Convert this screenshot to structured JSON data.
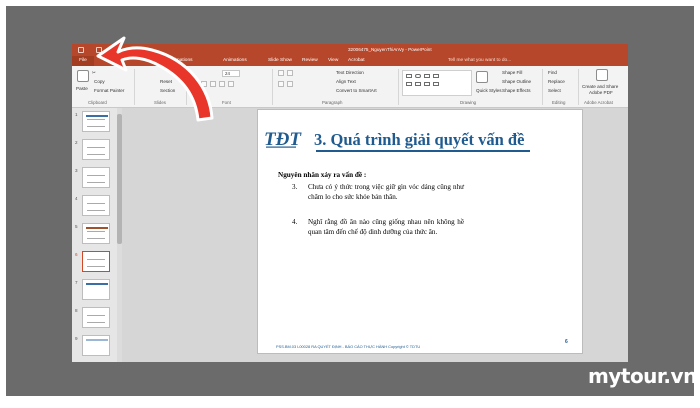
{
  "window": {
    "title": "32006475_NguyenThiAnVy - PowerPoint"
  },
  "tabs": [
    {
      "label": "File"
    },
    {
      "label": "nimations"
    },
    {
      "label": "Animations"
    },
    {
      "label": "Slide Show"
    },
    {
      "label": "Review"
    },
    {
      "label": "View"
    },
    {
      "label": "Acrobat"
    }
  ],
  "tell_me": {
    "placeholder": "Tell me what you want to do..."
  },
  "ribbon": {
    "paste": "Paste",
    "cut_icon": "scissors-icon",
    "copy": "Copy",
    "format_painter": "Format Painter",
    "reset": "Reset",
    "section": "Section",
    "font_size": "24",
    "text_direction": "Text Direction",
    "align_text": "Align Text",
    "convert_smartart": "Convert to SmartArt",
    "quick_styles": "Quick Styles",
    "shape_fill": "Shape Fill",
    "shape_outline": "Shape Outline",
    "shape_effects": "Shape Effects",
    "find": "Find",
    "replace": "Replace",
    "select": "Select",
    "create_pdf_line1": "Create and Share",
    "create_pdf_line2": "Adobe PDF",
    "groups": {
      "clipboard": "Clipboard",
      "slides": "Slides",
      "font": "Font",
      "paragraph": "Paragraph",
      "drawing": "Drawing",
      "editing": "Editing",
      "adobe_acrobat": "Adobe Acrobat"
    }
  },
  "thumbnails": [
    {
      "num": "1"
    },
    {
      "num": "2"
    },
    {
      "num": "3"
    },
    {
      "num": "4"
    },
    {
      "num": "5"
    },
    {
      "num": "6"
    },
    {
      "num": "7"
    },
    {
      "num": "8"
    },
    {
      "num": "9"
    }
  ],
  "slide": {
    "logo_text": "TĐT",
    "title": "3. Quá trình giải quyết vấn đề",
    "heading": "Nguyên nhân xảy ra vấn đề :",
    "items": [
      {
        "num": "3.",
        "text": "Chưa có ý thức trong việc giữ gìn vóc dáng cũng như chăm lo cho sức khỏe bản thân."
      },
      {
        "num": "4.",
        "text": "Nghĩ rằng đồ ăn nào cũng giống nhau nên không hề quan tâm đến chế độ dinh dưỡng của thức ăn."
      }
    ],
    "footer": "PSS.BM.03 L00028 RA QUYẾT ĐỊNH - BÁO CÁO THỰC HÀNH Copyright © TDTU",
    "page_number": "6"
  },
  "watermark": "mytour.vn",
  "colors": {
    "ppt_red": "#b7472a",
    "arrow_red": "#e8362a",
    "title_blue": "#1f5b8f"
  }
}
